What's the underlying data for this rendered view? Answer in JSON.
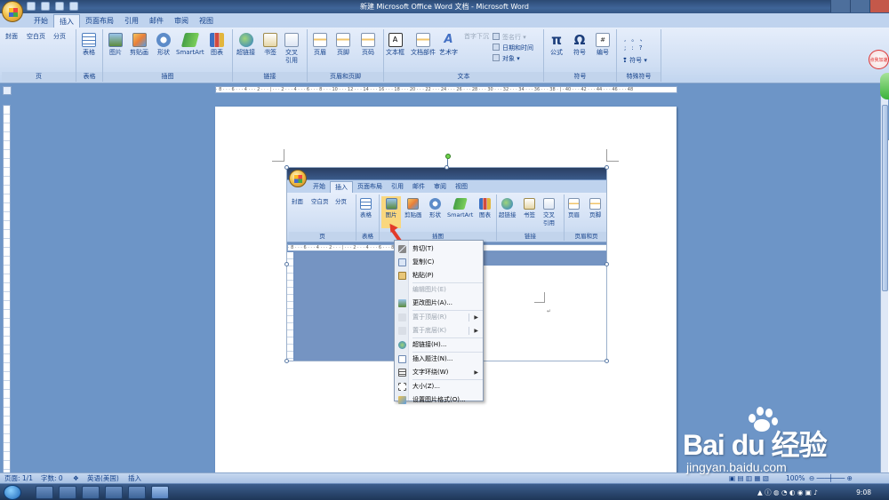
{
  "window": {
    "title": "新建 Microsoft Office Word 文档 - Microsoft Word"
  },
  "tabs": [
    "开始",
    "插入",
    "页面布局",
    "引用",
    "邮件",
    "审阅",
    "视图"
  ],
  "ribbon": {
    "groups": {
      "page": "页",
      "table": "表格",
      "illustrations": "插图",
      "links": "链接",
      "header_footer": "页眉和页脚",
      "text": "文本",
      "symbols": "符号",
      "special": "特殊符号"
    },
    "buttons": {
      "cover": "封面",
      "blank": "空白页",
      "break": "分页",
      "table": "表格",
      "picture": "图片",
      "clipart": "剪贴画",
      "shape": "形状",
      "smartart": "SmartArt",
      "chart": "图表",
      "hyperlink": "超链接",
      "bookmark": "书签",
      "crossref": "交叉\n引用",
      "header": "页眉",
      "footer": "页脚",
      "pagenum": "页码",
      "textbox": "文本框",
      "quickparts": "文档部件",
      "wordart": "艺术字",
      "dropcap": "首字下沉",
      "signature": "签名行",
      "datetime": "日期和时间",
      "object": "对象",
      "formula": "公式",
      "symbol": "符号",
      "number": "编号",
      "special_symbol": "符号"
    },
    "special_glyphs": [
      ",",
      "。",
      "、",
      ";",
      ":",
      "?"
    ]
  },
  "inner": {
    "tabs": [
      "开始",
      "插入",
      "页面布局",
      "引用",
      "邮件",
      "审阅",
      "视图"
    ],
    "buttons": {
      "cover": "封面",
      "blank": "空白页",
      "break": "分页",
      "table": "表格",
      "picture": "图片",
      "clipart": "剪贴画",
      "shape": "形状",
      "smartart": "SmartArt",
      "chart": "图表",
      "hyperlink": "超链接",
      "bookmark": "书签",
      "crossref": "交叉\n引用",
      "header": "页眉",
      "footer": "页脚"
    },
    "groups": {
      "page": "页",
      "table": "表格",
      "illustrations": "插图",
      "links": "链接",
      "header_footer": "页眉和页"
    }
  },
  "context_menu": [
    {
      "label": "剪切(T)",
      "enabled": true
    },
    {
      "label": "复制(C)",
      "enabled": true
    },
    {
      "label": "粘贴(P)",
      "enabled": true
    },
    {
      "label": "编辑图片(E)",
      "enabled": false
    },
    {
      "label": "更改图片(A)...",
      "enabled": true
    },
    {
      "label": "置于顶层(R)",
      "enabled": false,
      "submenu": true
    },
    {
      "label": "置于底层(K)",
      "enabled": false,
      "submenu": true
    },
    {
      "label": "超链接(H)...",
      "enabled": true
    },
    {
      "label": "插入题注(N)...",
      "enabled": true
    },
    {
      "label": "文字环绕(W)",
      "enabled": true,
      "submenu": true
    },
    {
      "label": "大小(Z)...",
      "enabled": true
    },
    {
      "label": "设置图片格式(O)...",
      "enabled": true
    }
  ],
  "statusbar": {
    "page": "页面: 1/1",
    "words": "字数: 0",
    "language": "英语(美国)",
    "mode": "插入",
    "zoom": "100%"
  },
  "taskbar": {
    "clock": "9:08"
  },
  "ruler": {
    "text": "· 8 · · · 6 · · · 4 · · · 2 · · · | · · · 2 · · · 4 · · · 6 · · · 8 · · · 10 · · · 12 · · · 14 · · · 16 · · · 18 · · · 20 · · · 22 · · · 24 · · · 26 · · · 28 · · · 30 · · · 32 · · · 34 · · · 36 · · · 38 · | · 40 · · · 42 · · · 44 · · · 46 · · · 48"
  },
  "inner_ruler": {
    "text": "· 8 · · · 6 · · · 4 · · · 2 · · · | · · · 2 · · · 4 · · · 6 · · · 8 · · · 10 · · · 12 · · · 14"
  },
  "watermark": {
    "logo": "Bai du 经验",
    "url": "jingyan.baidu.com"
  },
  "badge": {
    "text": "点我加速"
  },
  "colors": {
    "ribbon": "#cfdef3",
    "workspace": "#6d95c7",
    "accent": "#15428b",
    "arrow": "#e23a2a"
  }
}
